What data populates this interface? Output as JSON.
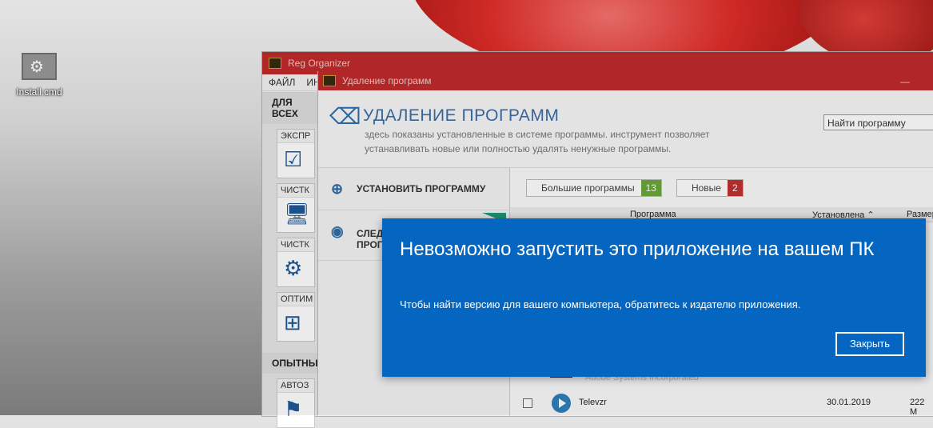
{
  "desktop": {
    "icon_label": "Install.cmd"
  },
  "main_window": {
    "title": "Reg Organizer",
    "menu": [
      "ФАЙЛ",
      "ИН"
    ],
    "section1": "ДЛЯ ВСЕХ",
    "cards": [
      "ЭКСПР",
      "ЧИСТК",
      "ЧИСТК",
      "ОПТИМ"
    ],
    "section2": "ОПЫТНЫ",
    "card_bottom": "АВТОЗ"
  },
  "uninstall_window": {
    "title": "Удаление программ",
    "heading": "УДАЛЕНИЕ ПРОГРАММ",
    "description": "здесь показаны установленные в системе программы. инструмент позволяет устанавливать новые или полностью удалять ненужные программы.",
    "search_placeholder": "Найти программу",
    "side_install": "УСТАНОВИТЬ ПРОГРАММУ",
    "side_tracked_1": "СЛЕД",
    "side_tracked_2": "ПРОГ",
    "tag_big": "Большие программы",
    "tag_big_count": "13",
    "tag_new": "Новые",
    "tag_new_count": "2",
    "col_program": "Программа",
    "col_installed": "Установлена ⌃",
    "col_size": "Размер",
    "faded_publisher": "Adobe Systems Incorporated",
    "row": {
      "name": "Televzr",
      "date": "30.01.2019",
      "size": "222 M"
    }
  },
  "dialog": {
    "title": "Невозможно запустить это приложение на вашем ПК",
    "message": "Чтобы найти версию для вашего компьютера, обратитесь к издателю приложения.",
    "close_label": "Закрыть",
    "background": "#0466c0"
  }
}
